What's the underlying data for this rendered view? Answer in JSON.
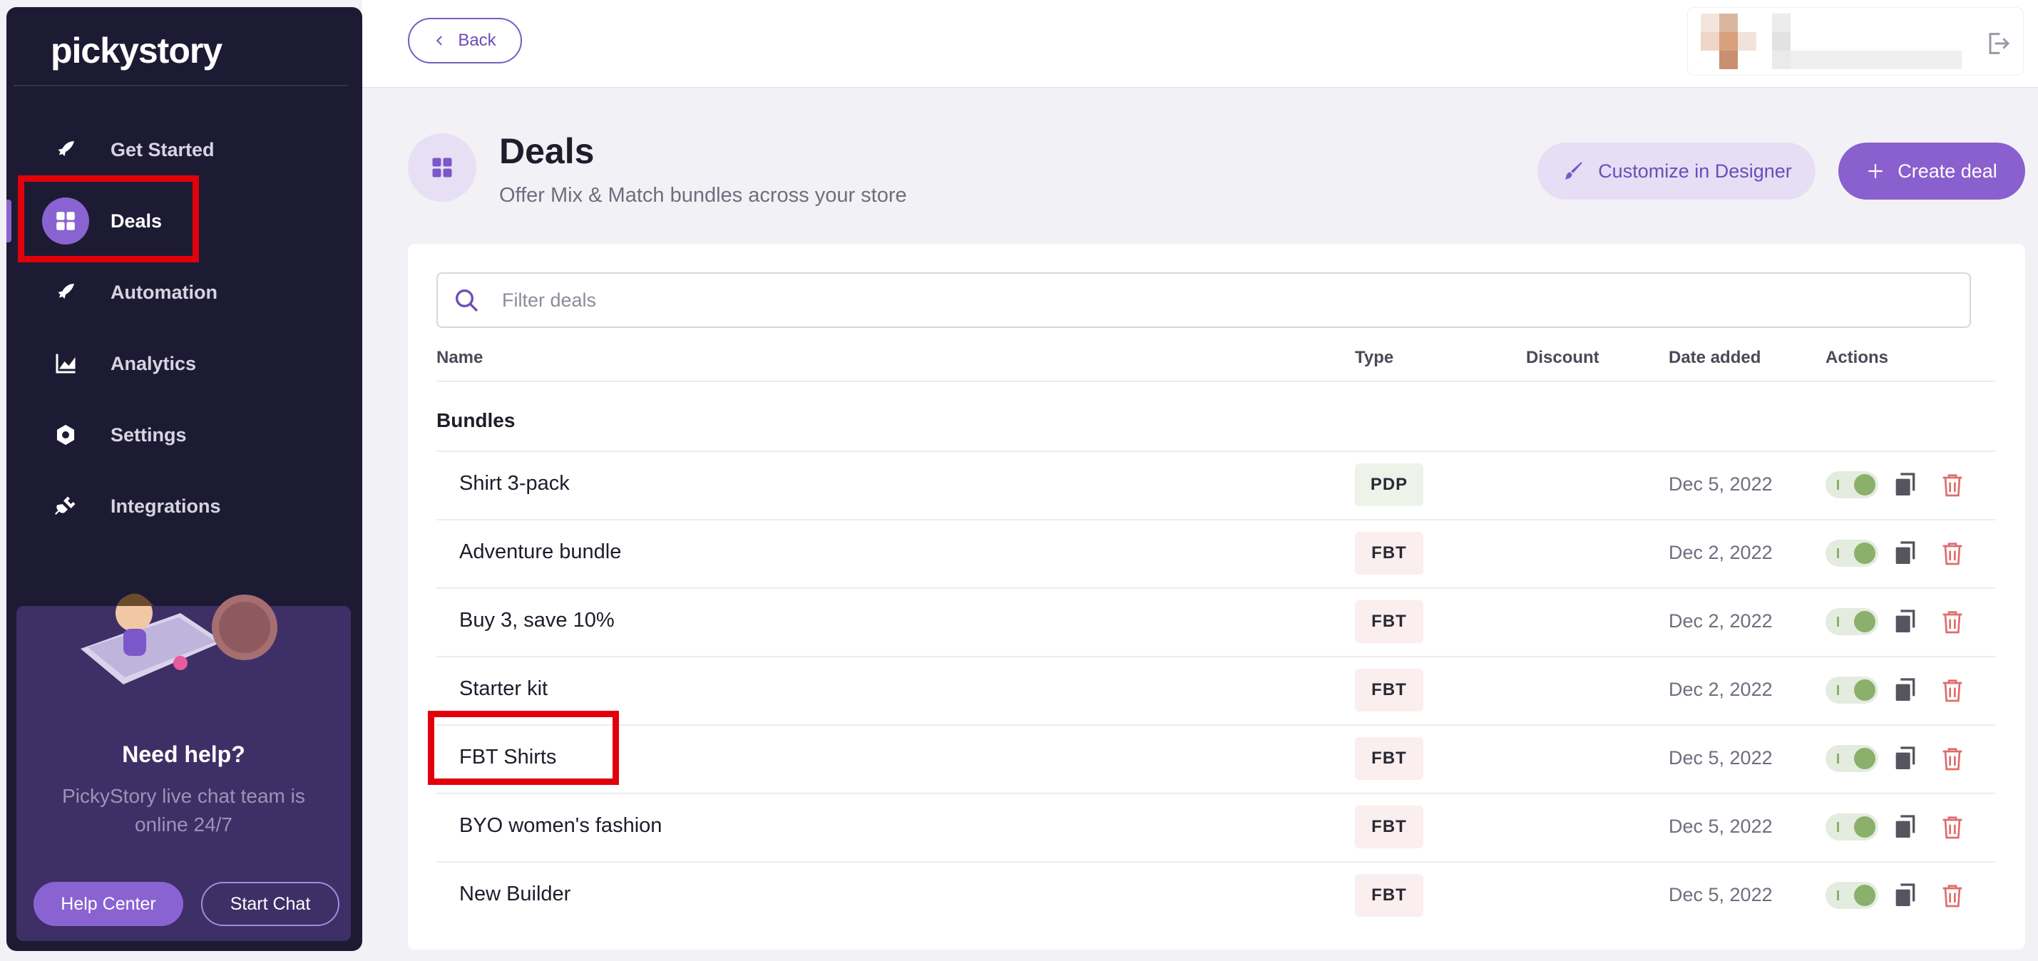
{
  "sidebar": {
    "logo_text": "pickystory",
    "items": [
      {
        "label": "Get Started",
        "icon": "rocket-icon"
      },
      {
        "label": "Deals",
        "icon": "grid-icon"
      },
      {
        "label": "Automation",
        "icon": "rocket-icon"
      },
      {
        "label": "Analytics",
        "icon": "chart-icon"
      },
      {
        "label": "Settings",
        "icon": "gear-icon"
      },
      {
        "label": "Integrations",
        "icon": "plug-icon"
      }
    ],
    "active_item": "Deals",
    "help": {
      "title": "Need help?",
      "subtitle": "PickyStory live chat team is online 24/7",
      "help_center_label": "Help Center",
      "start_chat_label": "Start Chat"
    }
  },
  "topbar": {
    "back_label": "Back"
  },
  "header": {
    "title": "Deals",
    "subtitle": "Offer Mix & Match bundles across your store",
    "customize_label": "Customize in Designer",
    "create_label": "Create deal"
  },
  "table": {
    "filter_placeholder": "Filter deals",
    "columns": {
      "name": "Name",
      "type": "Type",
      "discount": "Discount",
      "date": "Date added",
      "actions": "Actions"
    },
    "group_label": "Bundles",
    "rows": [
      {
        "name": "Shirt 3-pack",
        "type": "PDP",
        "discount": "",
        "date": "Dec 5, 2022",
        "enabled": true
      },
      {
        "name": "Adventure bundle",
        "type": "FBT",
        "discount": "",
        "date": "Dec 2, 2022",
        "enabled": true
      },
      {
        "name": "Buy 3, save 10%",
        "type": "FBT",
        "discount": "",
        "date": "Dec 2, 2022",
        "enabled": true
      },
      {
        "name": "Starter kit",
        "type": "FBT",
        "discount": "",
        "date": "Dec 2, 2022",
        "enabled": true
      },
      {
        "name": "FBT Shirts",
        "type": "FBT",
        "discount": "",
        "date": "Dec 5, 2022",
        "enabled": true
      },
      {
        "name": "BYO women's fashion",
        "type": "FBT",
        "discount": "",
        "date": "Dec 5, 2022",
        "enabled": true
      },
      {
        "name": "New Builder",
        "type": "FBT",
        "discount": "",
        "date": "Dec 5, 2022",
        "enabled": true
      }
    ]
  },
  "colors": {
    "sidebar_bg": "#1d1b33",
    "accent": "#8a63d2",
    "highlight": "#e2000b",
    "toggle_on": "#8ab06c"
  }
}
